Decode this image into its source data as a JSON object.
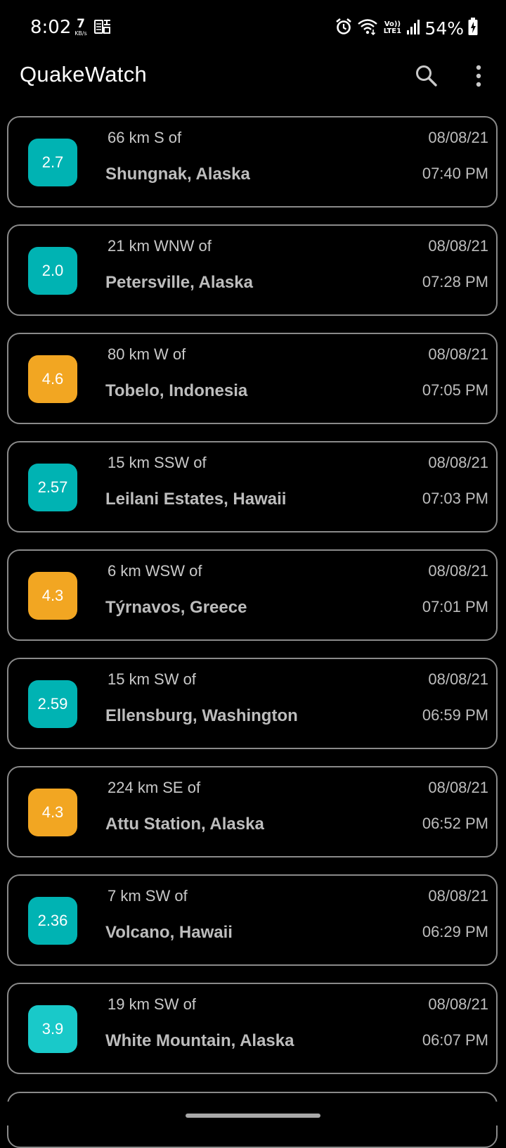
{
  "status_bar": {
    "time": "8:02",
    "net_speed_value": "7",
    "net_speed_unit": "KB/s",
    "notification_icon": "sim-toolkit-icon",
    "icons": [
      "alarm-icon",
      "wifi-icon",
      "volte-icon",
      "signal-icon",
      "battery-charging-icon"
    ],
    "volte_top": "Vo))",
    "volte_bottom": "LTE1",
    "battery": "54%"
  },
  "app_bar": {
    "title": "QuakeWatch",
    "actions": [
      "search-icon",
      "more-vert-icon"
    ]
  },
  "colors": {
    "background": "#000000",
    "card_border": "#8a8a8a",
    "mag_low": "#00B3B3",
    "mag_low_bright": "#19C9C9",
    "mag_mid": "#F2A622",
    "text_primary": "#bdbdbd"
  },
  "quakes": [
    {
      "magnitude": "2.7",
      "offset": "66 km S  of",
      "place": "Shungnak, Alaska",
      "date": "08/08/21",
      "time": "07:40 PM",
      "color": "#00B3B3"
    },
    {
      "magnitude": "2.0",
      "offset": "21 km WNW  of",
      "place": "Petersville, Alaska",
      "date": "08/08/21",
      "time": "07:28 PM",
      "color": "#00B3B3"
    },
    {
      "magnitude": "4.6",
      "offset": "80 km W  of",
      "place": "Tobelo, Indonesia",
      "date": "08/08/21",
      "time": "07:05 PM",
      "color": "#F2A622"
    },
    {
      "magnitude": "2.57",
      "offset": "15 km SSW  of",
      "place": "Leilani Estates, Hawaii",
      "date": "08/08/21",
      "time": "07:03 PM",
      "color": "#00B3B3"
    },
    {
      "magnitude": "4.3",
      "offset": "6 km WSW  of",
      "place": "Týrnavos, Greece",
      "date": "08/08/21",
      "time": "07:01 PM",
      "color": "#F2A622"
    },
    {
      "magnitude": "2.59",
      "offset": "15 km SW  of",
      "place": "Ellensburg, Washington",
      "date": "08/08/21",
      "time": "06:59 PM",
      "color": "#00B3B3"
    },
    {
      "magnitude": "4.3",
      "offset": "224 km SE  of",
      "place": "Attu Station, Alaska",
      "date": "08/08/21",
      "time": "06:52 PM",
      "color": "#F2A622"
    },
    {
      "magnitude": "2.36",
      "offset": "7 km SW  of",
      "place": "Volcano, Hawaii",
      "date": "08/08/21",
      "time": "06:29 PM",
      "color": "#00B3B3"
    },
    {
      "magnitude": "3.9",
      "offset": "19 km SW  of",
      "place": "White Mountain, Alaska",
      "date": "08/08/21",
      "time": "06:07 PM",
      "color": "#19C9C9"
    }
  ]
}
